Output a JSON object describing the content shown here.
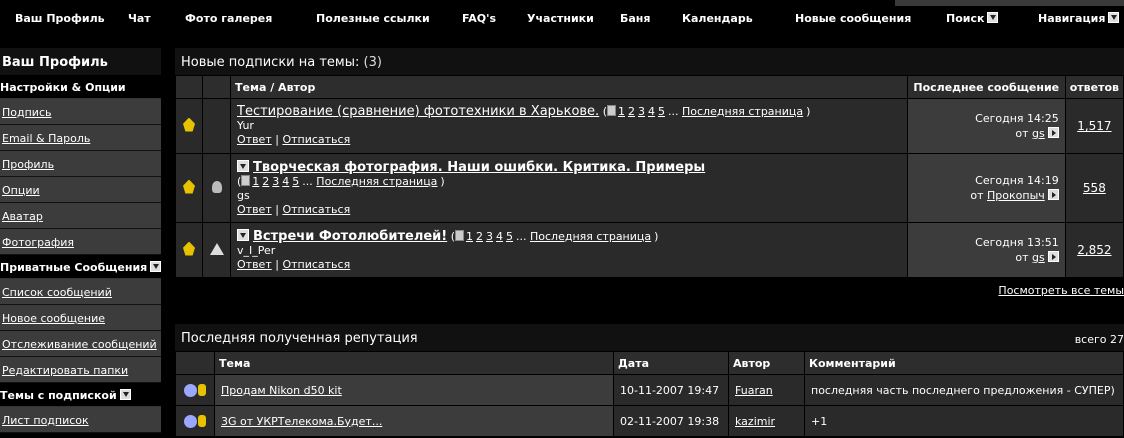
{
  "topnav": {
    "items": [
      {
        "label": "Ваш Профиль"
      },
      {
        "label": "Чат"
      },
      {
        "label": "Фото галерея"
      },
      {
        "label": "Полезные ссылки"
      },
      {
        "label": "FAQ's"
      },
      {
        "label": "Участники"
      },
      {
        "label": "Баня"
      },
      {
        "label": "Календарь"
      },
      {
        "label": "Новые сообщения"
      },
      {
        "label": "Поиск"
      },
      {
        "label": "Навигация"
      }
    ]
  },
  "sidebar": {
    "title": "Ваш Профиль",
    "sections": [
      {
        "heading": "Настройки & Опции",
        "items": [
          "Подпись",
          "Email & Пароль",
          "Профиль",
          "Опции",
          "Аватар",
          "Фотография"
        ]
      },
      {
        "heading": "Приватные Сообщения",
        "items": [
          "Список сообщений",
          "Новое сообщение",
          "Отслеживание сообщений",
          "Редактировать папки"
        ]
      },
      {
        "heading": "Темы с подпиской",
        "items": [
          "Лист подписок"
        ]
      }
    ]
  },
  "subscriptions": {
    "title": "Новые подписки на темы:",
    "count": "(3)",
    "columns": {
      "topic": "Тема / Автор",
      "last": "Последнее сообщение",
      "replies": "ответов"
    },
    "reply_label": "Ответ",
    "unsubscribe_label": "Отписаться",
    "last_page_label": "Последняя страница",
    "from_label": "от",
    "rows": [
      {
        "title": "Тестирование (сравнение) фототехники в Харькове.",
        "pages": [
          "1",
          "2",
          "3",
          "4",
          "5"
        ],
        "author": "Yur",
        "last_time": "Сегодня 14:25",
        "last_user": "gs",
        "replies": "1,517"
      },
      {
        "title": "Творческая фотография. Наши ошибки. Критика. Примеры",
        "pages": [
          "1",
          "2",
          "3",
          "4",
          "5"
        ],
        "author": "gs",
        "last_time": "Сегодня 14:19",
        "last_user": "Прокопыч",
        "replies": "558"
      },
      {
        "title": "Встречи Фотолюбителей!",
        "pages": [
          "1",
          "2",
          "3",
          "4",
          "5"
        ],
        "author": "v_I_Per",
        "last_time": "Сегодня 13:51",
        "last_user": "gs",
        "replies": "2,852"
      }
    ],
    "view_all": "Посмотреть все темы"
  },
  "reputation": {
    "title": "Последняя полученная репутация",
    "total": "всего 27",
    "columns": {
      "topic": "Тема",
      "date": "Дата",
      "author": "Автор",
      "comment": "Комментарий"
    },
    "rows": [
      {
        "topic": "Продам Nikon d50 kit",
        "date": "10-11-2007 19:47",
        "author": "Fuaran",
        "comment": "последняя часть последнего предложения - СУПЕР)"
      },
      {
        "topic": "3G от УКРТелекома.Будет...",
        "date": "02-11-2007 19:38",
        "author": "kazimir",
        "comment": "+1"
      }
    ]
  }
}
